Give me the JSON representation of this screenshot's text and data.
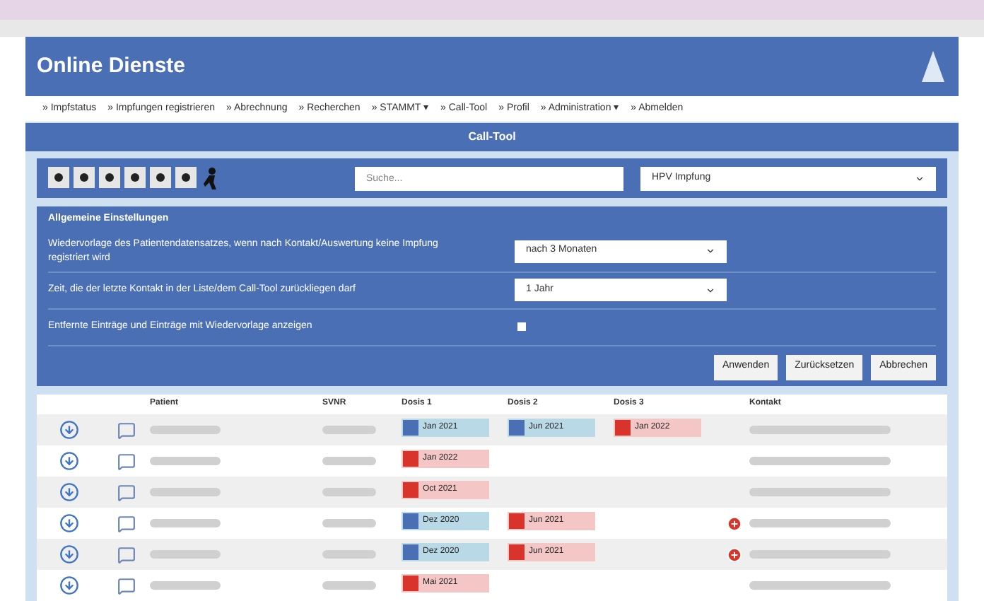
{
  "header": {
    "title": "Online Dienste"
  },
  "nav": [
    "» Impfstatus",
    "» Impfungen registrieren",
    "» Abrechnung",
    "» Recherchen",
    "» STAMMT ▾",
    "» Call-Tool",
    "» Profil",
    "» Administration ▾",
    "» Abmelden"
  ],
  "page_title": "Call-Tool",
  "toolbar": {
    "search": {
      "placeholder": "Suche..."
    },
    "filter": {
      "value": "HPV Impfung"
    }
  },
  "settings": {
    "title": "Allgemeine Einstellungen",
    "rows": [
      {
        "kind": "select",
        "label": "Wiedervorlage des Patientendatensatzes, wenn nach Kontakt/Auswertung keine Impfung registriert wird",
        "value": "nach 3 Monaten"
      },
      {
        "kind": "select",
        "label": "Zeit, die der letzte Kontakt in der Liste/dem Call-Tool zurückliegen darf",
        "value": "1 Jahr"
      },
      {
        "kind": "checkbox",
        "label": "Entfernte Einträge und Einträge mit Wiedervorlage anzeigen",
        "checked": false
      }
    ],
    "buttons": [
      "Anwenden",
      "Zurücksetzen",
      "Abbrechen"
    ]
  },
  "table": {
    "columns": [
      "Patient",
      "SVNR",
      "Dosis 1",
      "Dosis 2",
      "Dosis 3",
      "Kontakt"
    ],
    "rows": [
      {
        "doses": [
          {
            "label": "Jan 2021",
            "color": "#4a6fb5"
          },
          {
            "label": "Jun 2021",
            "color": "#4a6fb5"
          },
          {
            "label": "Jan 2022",
            "color": "#d9342b"
          }
        ],
        "alert": false
      },
      {
        "doses": [
          {
            "label": "Jan 2022",
            "color": "#d9342b"
          }
        ],
        "alert": false
      },
      {
        "doses": [
          {
            "label": "Oct 2021",
            "color": "#d9342b"
          }
        ],
        "alert": false
      },
      {
        "doses": [
          {
            "label": "Dez 2020",
            "color": "#4a6fb5"
          },
          {
            "label": "Jun 2021",
            "color": "#d9342b"
          }
        ],
        "alert": true
      },
      {
        "doses": [
          {
            "label": "Dez 2020",
            "color": "#4a6fb5"
          },
          {
            "label": "Jun 2021",
            "color": "#d9342b"
          }
        ],
        "alert": true
      },
      {
        "doses": [
          {
            "label": "Mai 2021",
            "color": "#d9342b"
          }
        ],
        "alert": false
      }
    ]
  }
}
